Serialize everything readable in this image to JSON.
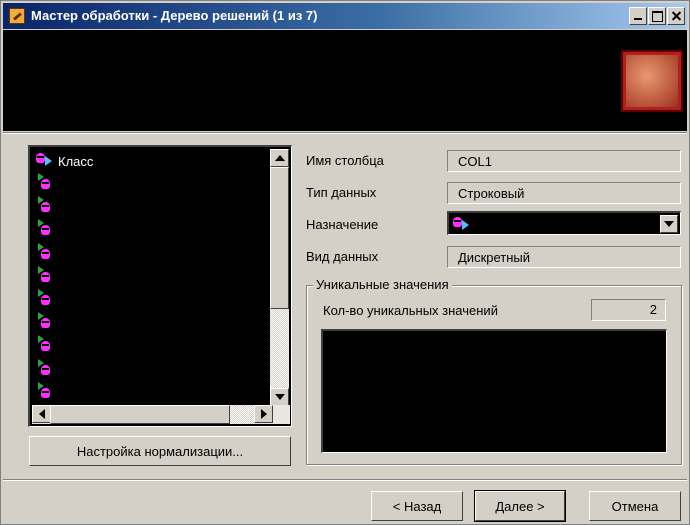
{
  "window": {
    "title": "Мастер обработки - Дерево решений (1 из 7)",
    "title_bar_colors": [
      "#0a246a",
      "#a6caf0"
    ]
  },
  "columns_list": {
    "header_label": "Класс",
    "row_count": 10
  },
  "form": {
    "column_name_label": "Имя столбца",
    "column_name_value": "COL1",
    "data_type_label": "Тип данных",
    "data_type_value": "Строковый",
    "purpose_label": "Назначение",
    "data_kind_label": "Вид данных",
    "data_kind_value": "Дискретный"
  },
  "unique_values": {
    "group_title": "Уникальные значения",
    "count_label": "Кол-во уникальных значений",
    "count_value": "2"
  },
  "buttons": {
    "normalization": "Настройка нормализации...",
    "back": "< Назад",
    "next": "Далее >",
    "cancel": "Отмена"
  },
  "colors": {
    "face": "#d4d0c8",
    "list_bg": "#000000",
    "icon_magenta": "#ff30ff",
    "icon_cyan": "#4fc0ff",
    "icon_green": "#30a040",
    "logo_red": "#b02020"
  }
}
